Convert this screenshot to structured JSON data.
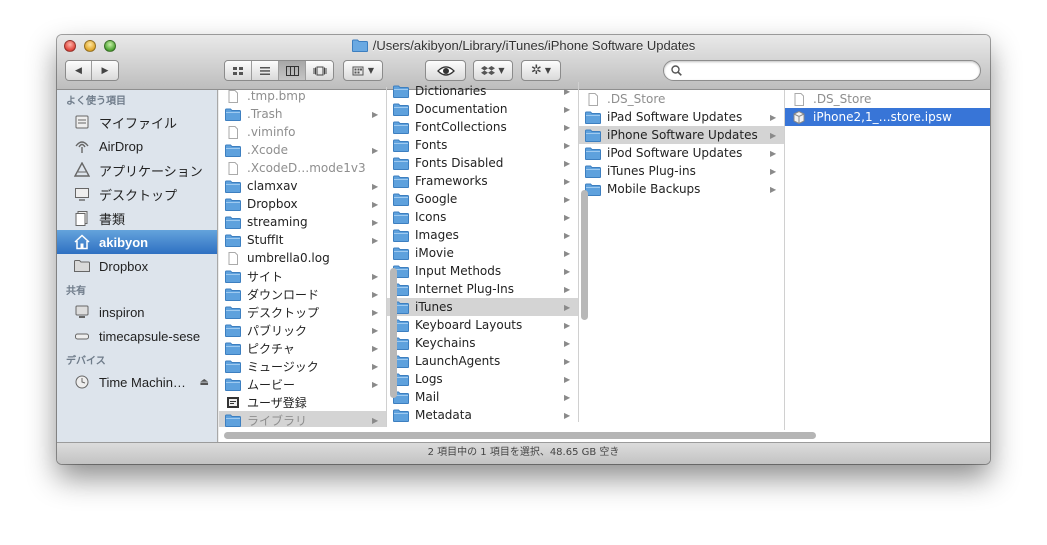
{
  "window": {
    "title": "/Users/akibyon/Library/iTunes/iPhone Software Updates",
    "status": "2 項目中の 1 項目を選択、48.65 GB 空き"
  },
  "toolbar": {
    "nav": [
      "◀",
      "▶"
    ],
    "view_modes": [
      "icon-view",
      "list-view",
      "column-view",
      "coverflow-view"
    ],
    "active_view": "column-view",
    "search": {
      "value": "",
      "placeholder": ""
    }
  },
  "sidebar": {
    "sections": [
      {
        "title": "よく使う項目",
        "items": [
          {
            "label": "マイファイル",
            "icon": "all-my-files-icon"
          },
          {
            "label": "AirDrop",
            "icon": "airdrop-icon"
          },
          {
            "label": "アプリケーション",
            "icon": "applications-icon"
          },
          {
            "label": "デスクトップ",
            "icon": "desktop-icon"
          },
          {
            "label": "書類",
            "icon": "documents-icon"
          },
          {
            "label": "akibyon",
            "icon": "home-icon",
            "selected": true
          },
          {
            "label": "Dropbox",
            "icon": "folder-icon"
          }
        ]
      },
      {
        "title": "共有",
        "items": [
          {
            "label": "inspiron",
            "icon": "monitor-icon"
          },
          {
            "label": "timecapsule-sese",
            "icon": "timecapsule-icon"
          }
        ]
      },
      {
        "title": "デバイス",
        "items": [
          {
            "label": "Time Machin…",
            "icon": "disk-icon",
            "eject": true
          }
        ]
      }
    ]
  },
  "columns": [
    {
      "items": [
        {
          "name": ".tmp.bmp",
          "kind": "file",
          "dim": true
        },
        {
          "name": ".Trash",
          "kind": "folder",
          "dim": true,
          "arrow": true
        },
        {
          "name": ".viminfo",
          "kind": "file",
          "dim": true
        },
        {
          "name": ".Xcode",
          "kind": "folder",
          "dim": true,
          "arrow": true
        },
        {
          "name": ".XcodeD…mode1v3",
          "kind": "file",
          "dim": true
        },
        {
          "name": "clamxav",
          "kind": "folder",
          "arrow": true
        },
        {
          "name": "Dropbox",
          "kind": "folder",
          "arrow": true
        },
        {
          "name": "streaming",
          "kind": "folder",
          "arrow": true
        },
        {
          "name": "StuffIt",
          "kind": "folder",
          "arrow": true
        },
        {
          "name": "umbrella0.log",
          "kind": "file"
        },
        {
          "name": "サイト",
          "kind": "folder",
          "arrow": true
        },
        {
          "name": "ダウンロード",
          "kind": "folder",
          "arrow": true
        },
        {
          "name": "デスクトップ",
          "kind": "folder",
          "arrow": true
        },
        {
          "name": "パブリック",
          "kind": "folder",
          "arrow": true
        },
        {
          "name": "ピクチャ",
          "kind": "folder",
          "arrow": true
        },
        {
          "name": "ミュージック",
          "kind": "folder",
          "arrow": true
        },
        {
          "name": "ムービー",
          "kind": "folder",
          "arrow": true
        },
        {
          "name": "ユーザ登録",
          "kind": "app"
        },
        {
          "name": "ライブラリ",
          "kind": "folder",
          "arrow": true,
          "state": "hl",
          "dim": true
        }
      ]
    },
    {
      "items": [
        {
          "name": "Dictionaries",
          "kind": "folder",
          "arrow": true
        },
        {
          "name": "Documentation",
          "kind": "folder",
          "arrow": true
        },
        {
          "name": "FontCollections",
          "kind": "folder",
          "arrow": true
        },
        {
          "name": "Fonts",
          "kind": "folder",
          "arrow": true
        },
        {
          "name": "Fonts Disabled",
          "kind": "folder",
          "arrow": true
        },
        {
          "name": "Frameworks",
          "kind": "folder",
          "arrow": true
        },
        {
          "name": "Google",
          "kind": "folder",
          "arrow": true
        },
        {
          "name": "Icons",
          "kind": "folder",
          "arrow": true
        },
        {
          "name": "Images",
          "kind": "folder",
          "arrow": true
        },
        {
          "name": "iMovie",
          "kind": "folder",
          "arrow": true
        },
        {
          "name": "Input Methods",
          "kind": "folder",
          "arrow": true
        },
        {
          "name": "Internet Plug-Ins",
          "kind": "folder",
          "arrow": true
        },
        {
          "name": "iTunes",
          "kind": "folder",
          "arrow": true,
          "state": "hl"
        },
        {
          "name": "Keyboard Layouts",
          "kind": "folder",
          "arrow": true
        },
        {
          "name": "Keychains",
          "kind": "folder",
          "arrow": true
        },
        {
          "name": "LaunchAgents",
          "kind": "folder",
          "arrow": true
        },
        {
          "name": "Logs",
          "kind": "folder",
          "arrow": true
        },
        {
          "name": "Mail",
          "kind": "folder",
          "arrow": true
        },
        {
          "name": "Metadata",
          "kind": "folder",
          "arrow": true
        }
      ]
    },
    {
      "items": [
        {
          "name": ".DS_Store",
          "kind": "file",
          "dim": true
        },
        {
          "name": "iPad Software Updates",
          "kind": "folder",
          "arrow": true
        },
        {
          "name": "iPhone Software Updates",
          "kind": "folder",
          "arrow": true,
          "state": "hl"
        },
        {
          "name": "iPod Software Updates",
          "kind": "folder",
          "arrow": true
        },
        {
          "name": "iTunes Plug-ins",
          "kind": "folder",
          "arrow": true
        },
        {
          "name": "Mobile Backups",
          "kind": "folder",
          "arrow": true
        }
      ]
    },
    {
      "items": [
        {
          "name": ".DS_Store",
          "kind": "file",
          "dim": true
        },
        {
          "name": "iPhone2,1_…store.ipsw",
          "kind": "ipsw",
          "state": "sel"
        }
      ]
    }
  ],
  "colors": {
    "selection": "#3875d7",
    "sidebar": "#dde4ec",
    "folder": "#5ea1dd"
  }
}
